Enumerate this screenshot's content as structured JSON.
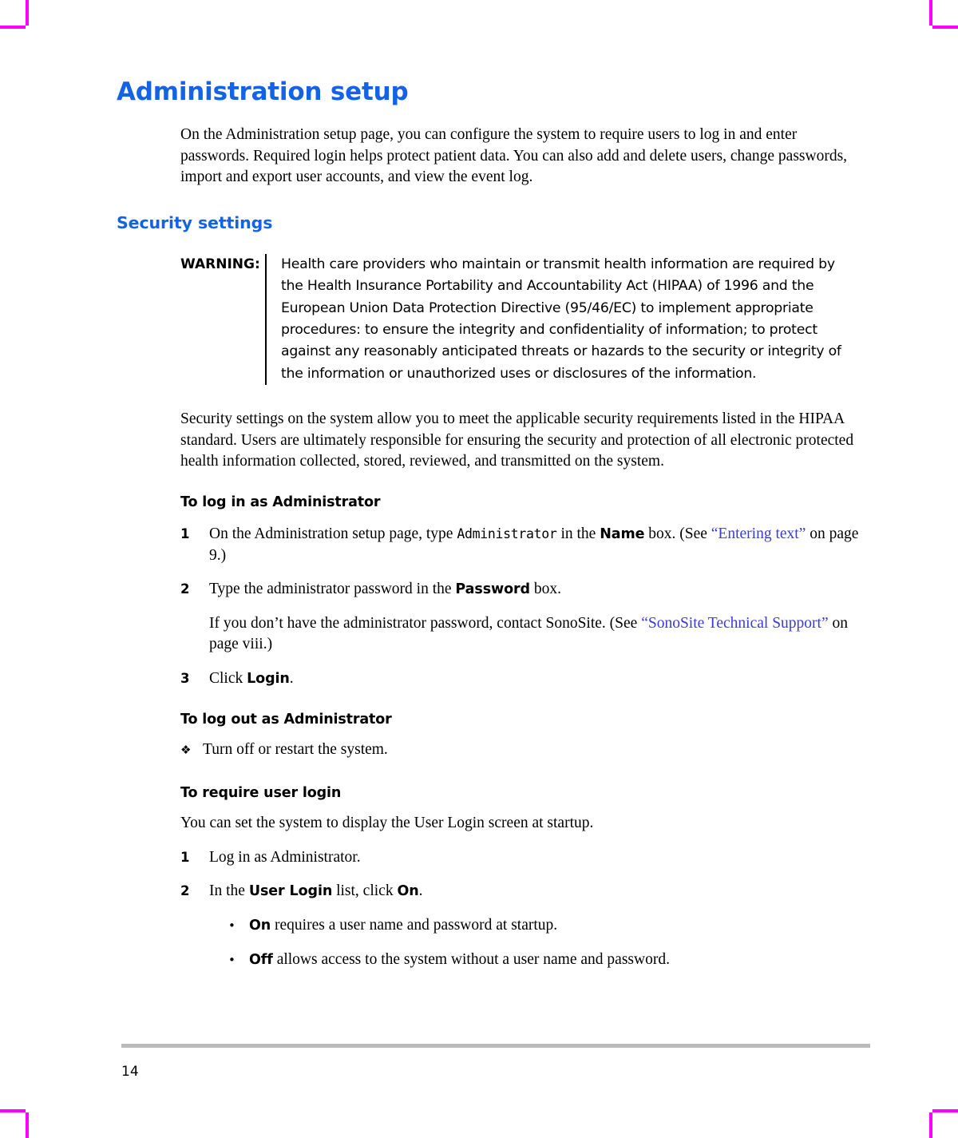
{
  "document": {
    "chapter_title": "Administration setup",
    "intro_paragraph": "On the Administration setup page, you can configure the system to require users to log in and enter passwords. Required login helps protect patient data. You can also add and delete users, change passwords, import and export user accounts, and view the event log.",
    "section_title": "Security settings",
    "warning": {
      "label": "WARNING:",
      "text": "Health care providers who maintain or transmit health information are required by the Health Insurance Portability and Accountability Act (HIPAA) of 1996 and the European Union Data Protection Directive (95/46/EC) to implement appropriate procedures: to ensure the integrity and confidentiality of information; to protect against any reasonably anticipated threats or hazards to the security or integrity of the information or unauthorized uses or disclosures of the information."
    },
    "security_paragraph": "Security settings on the system allow you to meet the applicable security requirements listed in the HIPAA standard. Users are ultimately responsible for ensuring the security and protection of all electronic protected health information collected, stored, reviewed, and transmitted on the system.",
    "procedures": [
      {
        "title": "To log in as Administrator",
        "steps": [
          {
            "number": "1",
            "parts": [
              {
                "type": "text",
                "value": "On the Administration setup page, type "
              },
              {
                "type": "mono",
                "value": "Administrator"
              },
              {
                "type": "text",
                "value": " in the "
              },
              {
                "type": "bold",
                "value": "Name"
              },
              {
                "type": "text",
                "value": " box. (See "
              },
              {
                "type": "xref",
                "value": "“Entering text”"
              },
              {
                "type": "text",
                "value": " on page 9.)"
              }
            ]
          },
          {
            "number": "2",
            "parts": [
              {
                "type": "text",
                "value": "Type the administrator password in the "
              },
              {
                "type": "bold",
                "value": "Password"
              },
              {
                "type": "text",
                "value": " box."
              }
            ],
            "sub_parts": [
              {
                "type": "text",
                "value": "If you don’t have the administrator password, contact SonoSite. (See "
              },
              {
                "type": "xref",
                "value": "“SonoSite Technical Support”"
              },
              {
                "type": "text",
                "value": " on page viii.)"
              }
            ]
          },
          {
            "number": "3",
            "parts": [
              {
                "type": "text",
                "value": "Click "
              },
              {
                "type": "bold",
                "value": "Login"
              },
              {
                "type": "text",
                "value": "."
              }
            ]
          }
        ]
      },
      {
        "title": "To log out as Administrator",
        "diamond_items": [
          {
            "bullet": "❖",
            "parts": [
              {
                "type": "text",
                "value": "Turn off or restart the system."
              }
            ]
          }
        ]
      },
      {
        "title": "To require user login",
        "lead_paragraph": "You can set the system to display the User Login screen at startup.",
        "steps": [
          {
            "number": "1",
            "parts": [
              {
                "type": "text",
                "value": "Log in as Administrator."
              }
            ]
          },
          {
            "number": "2",
            "parts": [
              {
                "type": "text",
                "value": "In the "
              },
              {
                "type": "bold",
                "value": "User Login"
              },
              {
                "type": "text",
                "value": " list, click "
              },
              {
                "type": "bold",
                "value": "On"
              },
              {
                "type": "text",
                "value": "."
              }
            ]
          }
        ],
        "dot_items": [
          {
            "bullet": "•",
            "parts": [
              {
                "type": "bold",
                "value": "On"
              },
              {
                "type": "text",
                "value": " requires a user name and password at startup."
              }
            ]
          },
          {
            "bullet": "•",
            "parts": [
              {
                "type": "bold",
                "value": "Off"
              },
              {
                "type": "text",
                "value": " allows access to the system without a user name and password."
              }
            ]
          }
        ]
      }
    ],
    "footer": {
      "page_number": "14"
    },
    "colors": {
      "heading_blue": "#1463E6",
      "xref_blue": "#3B3BD8",
      "footer_rule": "#BBBBBB",
      "crop_mark": "#FF00FF"
    }
  }
}
